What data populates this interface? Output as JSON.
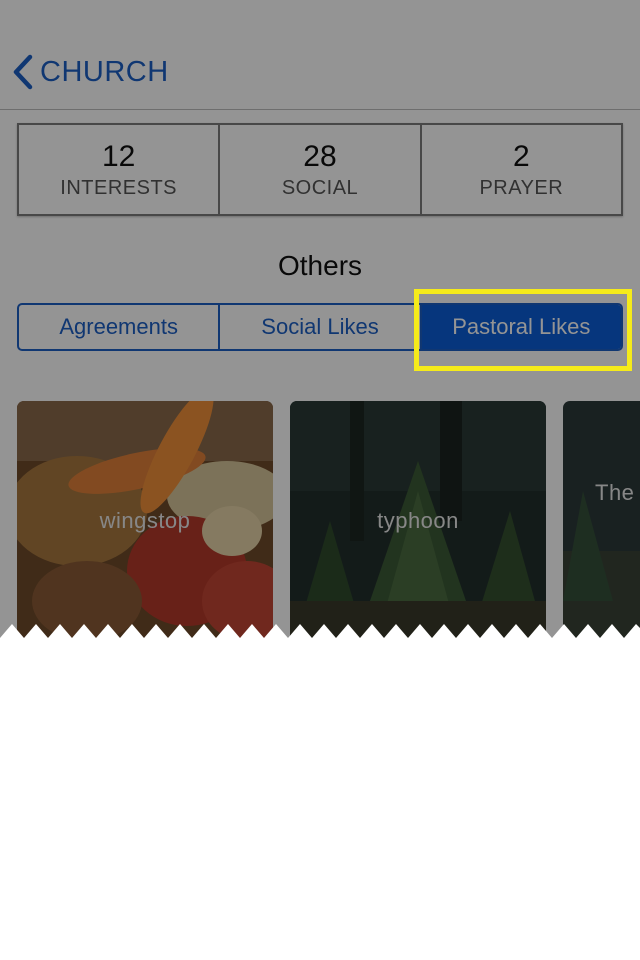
{
  "navbar": {
    "back_label": "CHURCH",
    "back_icon": "chevron-left-icon"
  },
  "stats": [
    {
      "value": "12",
      "label": "INTERESTS"
    },
    {
      "value": "28",
      "label": "SOCIAL"
    },
    {
      "value": "2",
      "label": "PRAYER"
    }
  ],
  "section": {
    "title": "Others"
  },
  "tabs": {
    "items": [
      {
        "label": "Agreements"
      },
      {
        "label": "Social Likes"
      },
      {
        "label": "Pastoral Likes"
      }
    ],
    "selected": "Pastoral Likes"
  },
  "cards": [
    {
      "label": "wingstop"
    },
    {
      "label": "typhoon"
    },
    {
      "label": "The"
    }
  ],
  "colors": {
    "accent": "#1d5fc4",
    "active_tab": "#0b5ed7",
    "highlight": "#f5eb1a",
    "overlay": "rgba(0,0,0,0.42)"
  }
}
